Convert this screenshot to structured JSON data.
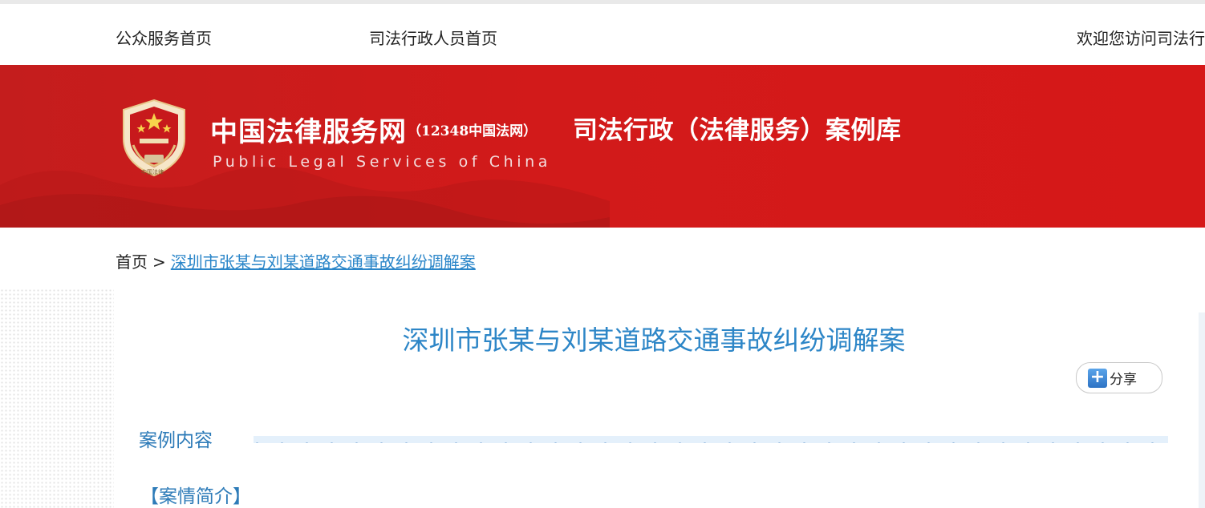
{
  "topnav": {
    "link_public": "公众服务首页",
    "link_staff": "司法行政人员首页",
    "welcome": "欢迎您访问司法行"
  },
  "banner": {
    "emblem_label": "中国法律",
    "site_name": "中国法律服务网",
    "site_sub": "（12348中国法网）",
    "site_en": "Public Legal Services of China",
    "library_title": "司法行政（法律服务）案例库"
  },
  "breadcrumb": {
    "home": "首页",
    "separator": ">",
    "current": "深圳市张某与刘某道路交通事故纠纷调解案"
  },
  "article": {
    "title": "深圳市张某与刘某道路交通事故纠纷调解案",
    "share_label": "分享",
    "section_heading": "案例内容",
    "subsection": "【案情简介】"
  },
  "colors": {
    "banner_red": "#d21a1a",
    "accent_blue": "#2d86c7"
  }
}
